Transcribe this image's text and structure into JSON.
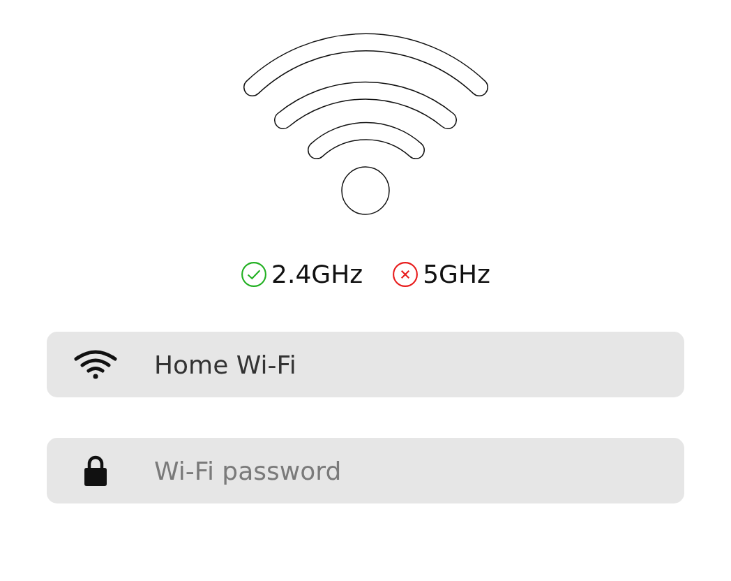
{
  "bands": [
    {
      "label": "2.4GHz",
      "available": true
    },
    {
      "label": "5GHz",
      "available": false
    }
  ],
  "fields": [
    {
      "kind": "network",
      "value": "Home Wi-Fi"
    },
    {
      "kind": "password",
      "placeholder": "Wi-Fi password"
    }
  ]
}
